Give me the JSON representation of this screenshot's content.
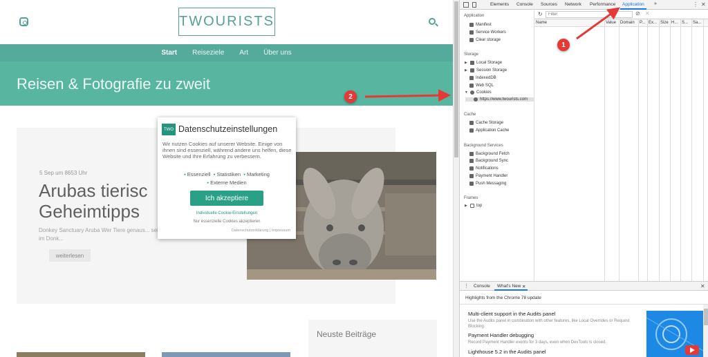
{
  "site": {
    "logo": "TWOURISTS",
    "nav": [
      "Start",
      "Reiseziele",
      "Art",
      "Über uns"
    ],
    "hero_title": "Reisen & Fotografie zu zweit",
    "post": {
      "date": "5 Sep um 8653 Uhr",
      "title": "Arubas tierisc Geheimtipps",
      "excerpt": "Donkey Sanctuary Aruba Wer Tiere genaus... seinem Besuch auf Aruba unbedingt im Donk...",
      "more": "weiterlesen"
    },
    "sidebar_title": "Neuste Beiträge"
  },
  "cookie_modal": {
    "logo": "TWO",
    "title": "Datenschutzeinstellungen",
    "text": "Wir nutzen Cookies auf unserer Website. Einige von ihnen sind essenziell, während andere uns helfen, diese Website und Ihre Erfahrung zu verbessern.",
    "options": [
      "Essenziell",
      "Statistiken",
      "Marketing",
      "Externe Medien"
    ],
    "accept": "Ich akzeptiere",
    "individual": "Individuelle Cookie-Einstellungen",
    "essential_only": "Nur essenzielle Cookies akzeptieren",
    "footer": "Datenschutzerklärung | Impressum"
  },
  "devtools": {
    "tabs": [
      "Elements",
      "Console",
      "Sources",
      "Network",
      "Performance",
      "Application"
    ],
    "more": "»",
    "sections": {
      "application": "Application",
      "storage": "Storage",
      "cache": "Cache",
      "background": "Background Services",
      "frames": "Frames"
    },
    "app_items": [
      "Manifest",
      "Service Workers",
      "Clear storage"
    ],
    "storage_items": [
      "Local Storage",
      "Session Storage",
      "IndexedDB",
      "Web SQL",
      "Cookies"
    ],
    "cookie_origin": "https://www.twourists.com",
    "cache_items": [
      "Cache Storage",
      "Application Cache"
    ],
    "bg_items": [
      "Background Fetch",
      "Background Sync",
      "Notifications",
      "Payment Handler",
      "Push Messaging"
    ],
    "frame_item": "top",
    "filter_placeholder": "Filter",
    "columns": [
      "Name",
      "Value",
      "Domain",
      "P...",
      "Ex...",
      "Size",
      "H...",
      "S...",
      "Sa..."
    ],
    "drawer": {
      "tabs": [
        "Console",
        "What's New"
      ],
      "highlights": "Highlights from the Chrome 78 update",
      "news": [
        {
          "title": "Multi-client support in the Audits panel",
          "desc": "Use the Audits panel in combination with other features, like Local Overrides or Request Blocking."
        },
        {
          "title": "Payment Handler debugging",
          "desc": "Record Payment Handler events for 3 days, even when DevTools is closed."
        },
        {
          "title": "Lighthouse 5.2 in the Audits panel",
          "desc": ""
        }
      ]
    }
  },
  "annotations": {
    "badge1": "1",
    "badge2": "2",
    "color": "#e53935"
  }
}
